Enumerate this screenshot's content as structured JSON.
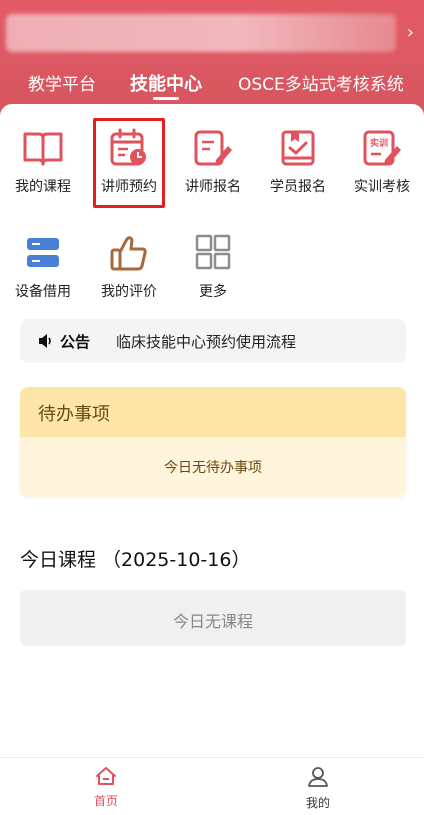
{
  "header": {
    "tabs": [
      {
        "label": "教学平台"
      },
      {
        "label": "技能中心"
      },
      {
        "label": "OSCE多站式考核系统"
      }
    ]
  },
  "grid": {
    "items": [
      {
        "label": "我的课程",
        "icon": "book-icon"
      },
      {
        "label": "讲师预约",
        "icon": "calendar-clock-icon"
      },
      {
        "label": "讲师报名",
        "icon": "form-edit-icon"
      },
      {
        "label": "学员报名",
        "icon": "clipboard-check-icon"
      },
      {
        "label": "实训考核",
        "icon": "training-exam-icon"
      },
      {
        "label": "设备借用",
        "icon": "equipment-icon"
      },
      {
        "label": "我的评价",
        "icon": "thumbs-up-icon"
      },
      {
        "label": "更多",
        "icon": "more-grid-icon"
      }
    ],
    "exam_badge": "实训"
  },
  "notice": {
    "tag": "公告",
    "text": "临床技能中心预约使用流程"
  },
  "todo": {
    "title": "待办事项",
    "empty_text": "今日无待办事项"
  },
  "today": {
    "title": "今日课程 （2025-10-16）",
    "empty_text": "今日无课程"
  },
  "bottom_nav": {
    "items": [
      {
        "label": "首页",
        "active": true
      },
      {
        "label": "我的",
        "active": false
      }
    ]
  },
  "colors": {
    "brand": "#d65660",
    "icon_red": "#e0525c",
    "icon_brown": "#a8693a",
    "icon_blue": "#4a7fd6",
    "icon_gray": "#8c8c8c"
  }
}
